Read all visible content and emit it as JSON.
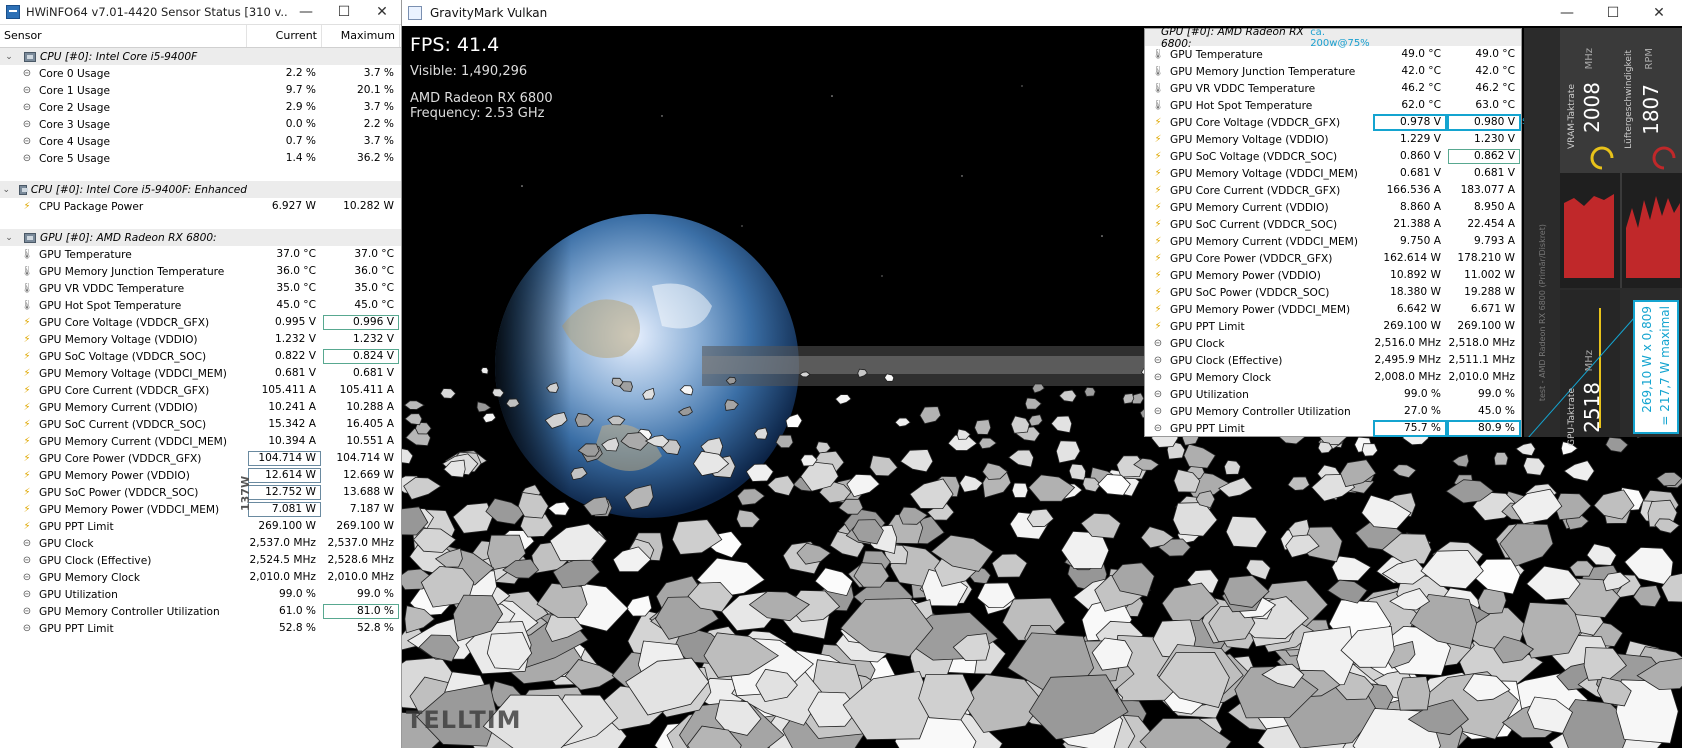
{
  "hwinfo": {
    "title": "HWiNFO64 v7.01-4420 Sensor Status [310 v...",
    "columns": {
      "sensor": "Sensor",
      "current": "Current",
      "maximum": "Maximum"
    },
    "window_buttons": {
      "minimize": "—",
      "maximize": "☐",
      "close": "✕"
    },
    "note_137": "137W",
    "rows": [
      {
        "kind": "group",
        "name": "CPU [#0]: Intel Core i5-9400F"
      },
      {
        "kind": "item",
        "icon": "clock",
        "name": "Core 0 Usage",
        "current": "2.2 %",
        "max": "3.7 %"
      },
      {
        "kind": "item",
        "icon": "clock",
        "name": "Core 1 Usage",
        "current": "9.7 %",
        "max": "20.1 %"
      },
      {
        "kind": "item",
        "icon": "clock",
        "name": "Core 2 Usage",
        "current": "2.9 %",
        "max": "3.7 %"
      },
      {
        "kind": "item",
        "icon": "clock",
        "name": "Core 3 Usage",
        "current": "0.0 %",
        "max": "2.2 %"
      },
      {
        "kind": "item",
        "icon": "clock",
        "name": "Core 4 Usage",
        "current": "0.7 %",
        "max": "3.7 %"
      },
      {
        "kind": "item",
        "icon": "clock",
        "name": "Core 5 Usage",
        "current": "1.4 %",
        "max": "36.2 %"
      },
      {
        "kind": "spacer"
      },
      {
        "kind": "group",
        "name": "CPU [#0]: Intel Core i5-9400F: Enhanced"
      },
      {
        "kind": "item",
        "icon": "volt",
        "name": "CPU Package Power",
        "current": "6.927 W",
        "max": "10.282 W"
      },
      {
        "kind": "spacer"
      },
      {
        "kind": "group",
        "name": "GPU [#0]: AMD Radeon RX 6800:"
      },
      {
        "kind": "item",
        "icon": "therm",
        "name": "GPU Temperature",
        "current": "37.0 °C",
        "max": "37.0 °C"
      },
      {
        "kind": "item",
        "icon": "therm",
        "name": "GPU Memory Junction Temperature",
        "current": "36.0 °C",
        "max": "36.0 °C"
      },
      {
        "kind": "item",
        "icon": "therm",
        "name": "GPU VR VDDC Temperature",
        "current": "35.0 °C",
        "max": "35.0 °C"
      },
      {
        "kind": "item",
        "icon": "therm",
        "name": "GPU Hot Spot Temperature",
        "current": "45.0 °C",
        "max": "45.0 °C"
      },
      {
        "kind": "item",
        "icon": "volt",
        "name": "GPU Core Voltage (VDDCR_GFX)",
        "current": "0.995 V",
        "max": "0.996 V",
        "box_max": true
      },
      {
        "kind": "item",
        "icon": "volt",
        "name": "GPU Memory Voltage (VDDIO)",
        "current": "1.232 V",
        "max": "1.232 V"
      },
      {
        "kind": "item",
        "icon": "volt",
        "name": "GPU SoC Voltage (VDDCR_SOC)",
        "current": "0.822 V",
        "max": "0.824 V",
        "box_max": true
      },
      {
        "kind": "item",
        "icon": "volt",
        "name": "GPU Memory Voltage (VDDCI_MEM)",
        "current": "0.681 V",
        "max": "0.681 V"
      },
      {
        "kind": "item",
        "icon": "volt",
        "name": "GPU Core Current (VDDCR_GFX)",
        "current": "105.411 A",
        "max": "105.411 A"
      },
      {
        "kind": "item",
        "icon": "volt",
        "name": "GPU Memory Current (VDDIO)",
        "current": "10.241 A",
        "max": "10.288 A"
      },
      {
        "kind": "item",
        "icon": "volt",
        "name": "GPU SoC Current (VDDCR_SOC)",
        "current": "15.342 A",
        "max": "16.405 A"
      },
      {
        "kind": "item",
        "icon": "volt",
        "name": "GPU Memory Current (VDDCI_MEM)",
        "current": "10.394 A",
        "max": "10.551 A"
      },
      {
        "kind": "item",
        "icon": "volt",
        "name": "GPU Core Power (VDDCR_GFX)",
        "current": "104.714 W",
        "max": "104.714 W",
        "box_cur": true
      },
      {
        "kind": "item",
        "icon": "volt",
        "name": "GPU Memory Power (VDDIO)",
        "current": "12.614 W",
        "max": "12.669 W",
        "box_cur": true
      },
      {
        "kind": "item",
        "icon": "volt",
        "name": "GPU SoC Power (VDDCR_SOC)",
        "current": "12.752 W",
        "max": "13.688 W",
        "box_cur": true
      },
      {
        "kind": "item",
        "icon": "volt",
        "name": "GPU Memory Power (VDDCI_MEM)",
        "current": "7.081 W",
        "max": "7.187 W",
        "box_cur": true
      },
      {
        "kind": "item",
        "icon": "volt",
        "name": "GPU PPT Limit",
        "current": "269.100 W",
        "max": "269.100 W"
      },
      {
        "kind": "item",
        "icon": "clock",
        "name": "GPU Clock",
        "current": "2,537.0 MHz",
        "max": "2,537.0 MHz"
      },
      {
        "kind": "item",
        "icon": "clock",
        "name": "GPU Clock (Effective)",
        "current": "2,524.5 MHz",
        "max": "2,528.6 MHz"
      },
      {
        "kind": "item",
        "icon": "clock",
        "name": "GPU Memory Clock",
        "current": "2,010.0 MHz",
        "max": "2,010.0 MHz"
      },
      {
        "kind": "item",
        "icon": "clock",
        "name": "GPU Utilization",
        "current": "99.0 %",
        "max": "99.0 %"
      },
      {
        "kind": "item",
        "icon": "clock",
        "name": "GPU Memory Controller Utilization",
        "current": "61.0 %",
        "max": "81.0 %",
        "box_max": true
      },
      {
        "kind": "item",
        "icon": "clock",
        "name": "GPU PPT Limit",
        "current": "52.8 %",
        "max": "52.8 %"
      }
    ]
  },
  "gravitymark": {
    "title": "GravityMark Vulkan",
    "window_buttons": {
      "minimize": "—",
      "maximize": "☐",
      "close": "✕"
    },
    "hud": {
      "fps": "FPS: 41.4",
      "visible": "Visible: 1,490,296",
      "gpu": "AMD Radeon RX 6800",
      "frequency": "Frequency: 2.53 GHz"
    },
    "watermark": "TELLTIM"
  },
  "overlay": {
    "group": "GPU [#0]: AMD Radeon RX 6800:",
    "note": "ca. 200w@75%",
    "spike": "spike",
    "rows": [
      {
        "icon": "therm",
        "name": "GPU Temperature",
        "current": "49.0 °C",
        "max": "49.0 °C"
      },
      {
        "icon": "therm",
        "name": "GPU Memory Junction Temperature",
        "current": "42.0 °C",
        "max": "42.0 °C"
      },
      {
        "icon": "therm",
        "name": "GPU VR VDDC Temperature",
        "current": "46.2 °C",
        "max": "46.2 °C"
      },
      {
        "icon": "therm",
        "name": "GPU Hot Spot Temperature",
        "current": "62.0 °C",
        "max": "63.0 °C"
      },
      {
        "icon": "volt",
        "name": "GPU Core Voltage (VDDCR_GFX)",
        "current": "0.978 V",
        "max": "0.980 V",
        "hl_cur": true,
        "hl_max": true
      },
      {
        "icon": "volt",
        "name": "GPU Memory Voltage (VDDIO)",
        "current": "1.229 V",
        "max": "1.230 V"
      },
      {
        "icon": "volt",
        "name": "GPU SoC Voltage (VDDCR_SOC)",
        "current": "0.860 V",
        "max": "0.862 V",
        "hlg_max": true
      },
      {
        "icon": "volt",
        "name": "GPU Memory Voltage (VDDCI_MEM)",
        "current": "0.681 V",
        "max": "0.681 V"
      },
      {
        "icon": "volt",
        "name": "GPU Core Current (VDDCR_GFX)",
        "current": "166.536 A",
        "max": "183.077 A"
      },
      {
        "icon": "volt",
        "name": "GPU Memory Current (VDDIO)",
        "current": "8.860 A",
        "max": "8.950 A"
      },
      {
        "icon": "volt",
        "name": "GPU SoC Current (VDDCR_SOC)",
        "current": "21.388 A",
        "max": "22.454 A"
      },
      {
        "icon": "volt",
        "name": "GPU Memory Current (VDDCI_MEM)",
        "current": "9.750 A",
        "max": "9.793 A"
      },
      {
        "icon": "volt",
        "name": "GPU Core Power (VDDCR_GFX)",
        "current": "162.614 W",
        "max": "178.210 W"
      },
      {
        "icon": "volt",
        "name": "GPU Memory Power (VDDIO)",
        "current": "10.892 W",
        "max": "11.002 W"
      },
      {
        "icon": "volt",
        "name": "GPU SoC Power (VDDCR_SOC)",
        "current": "18.380 W",
        "max": "19.288 W"
      },
      {
        "icon": "volt",
        "name": "GPU Memory Power (VDDCI_MEM)",
        "current": "6.642 W",
        "max": "6.671 W"
      },
      {
        "icon": "volt",
        "name": "GPU PPT Limit",
        "current": "269.100 W",
        "max": "269.100 W"
      },
      {
        "icon": "clock",
        "name": "GPU Clock",
        "current": "2,516.0 MHz",
        "max": "2,518.0 MHz"
      },
      {
        "icon": "clock",
        "name": "GPU Clock (Effective)",
        "current": "2,495.9 MHz",
        "max": "2,511.1 MHz"
      },
      {
        "icon": "clock",
        "name": "GPU Memory Clock",
        "current": "2,008.0 MHz",
        "max": "2,010.0 MHz"
      },
      {
        "icon": "clock",
        "name": "GPU Utilization",
        "current": "99.0 %",
        "max": "99.0 %"
      },
      {
        "icon": "clock",
        "name": "GPU Memory Controller Utilization",
        "current": "27.0 %",
        "max": "45.0 %"
      },
      {
        "icon": "clock",
        "name": "GPU PPT Limit",
        "current": "75.7 %",
        "max": "80.9 %",
        "hl_cur": true,
        "hl_max": true
      }
    ]
  },
  "sidebar_gadget": {
    "vram_label": "VRAM-Taktrate",
    "vram_value": "2008",
    "vram_unit": "MHz",
    "fan_label": "Lüftergeschwindigkeit",
    "fan_value": "1807",
    "fan_unit": "RPM",
    "gpu_label": "GPU-Taktrate",
    "gpu_value": "2518",
    "gpu_unit": "MHz",
    "gpu_caption": "test - AMD Radeon RX 6800 (Primär/Diskret)",
    "calc_line1": "269,10 W x 0,809",
    "calc_line2": "= 217,7 W maximal",
    "colors": {
      "gauge_yellow": "#e8c21a",
      "gauge_red": "#c0282a",
      "highlight": "#14a4d0",
      "box_green": "#58a890"
    }
  }
}
